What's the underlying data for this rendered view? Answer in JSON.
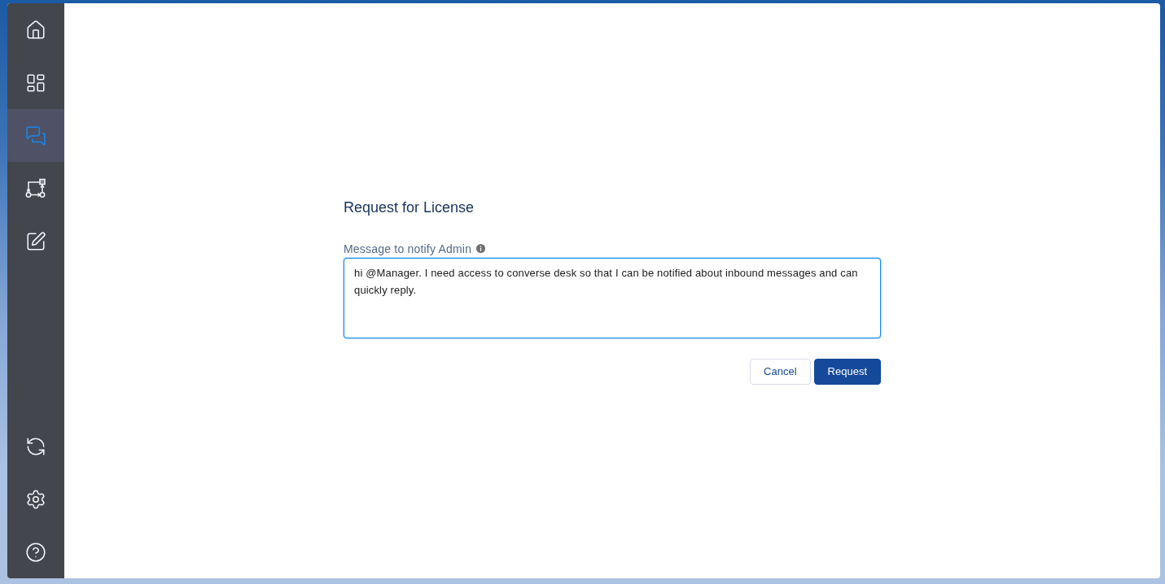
{
  "sidebar": {
    "items": [
      {
        "selected": false
      },
      {
        "selected": false
      },
      {
        "selected": true
      },
      {
        "selected": false
      },
      {
        "selected": false
      }
    ],
    "footer_items": [
      {
        "selected": false
      },
      {
        "selected": false
      },
      {
        "selected": false
      }
    ]
  },
  "form": {
    "title": "Request for License",
    "field": {
      "label": "Message to notify Admin",
      "value": "hi @Manager. I need access to converse desk so that I can be notified about inbound messages and can quickly reply.",
      "focused": true
    },
    "buttons": [
      {
        "label": "Cancel",
        "kind": "secondary"
      },
      {
        "label": "Request",
        "kind": "primary"
      }
    ]
  }
}
